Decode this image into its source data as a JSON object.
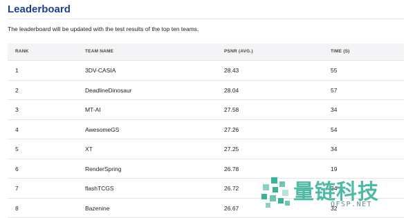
{
  "page": {
    "title": "Leaderboard",
    "description": "The leaderboard will be updated with the test results of the top ten teams."
  },
  "table": {
    "headers": [
      "RANK",
      "TEAM NAME",
      "PSNR (AVG.)",
      "TIME (S)"
    ],
    "rows": [
      [
        "1",
        "3DV-CASIA",
        "28.43",
        "55"
      ],
      [
        "2",
        "DeadlineDinosaur",
        "28.04",
        "57"
      ],
      [
        "3",
        "MT-AI",
        "27.58",
        "34"
      ],
      [
        "4",
        "AwesomeGS",
        "27.26",
        "54"
      ],
      [
        "5",
        "XT",
        "27.25",
        "34"
      ],
      [
        "6",
        "RenderSpring",
        "26.78",
        "19"
      ],
      [
        "7",
        "flashTCGS",
        "26.72",
        "34"
      ],
      [
        "8",
        "Bazenine",
        "26.67",
        "32"
      ]
    ]
  },
  "watermark": {
    "text_cn": "量链科技",
    "text_en": "QFSP.NET",
    "color": "#3bb39b"
  }
}
